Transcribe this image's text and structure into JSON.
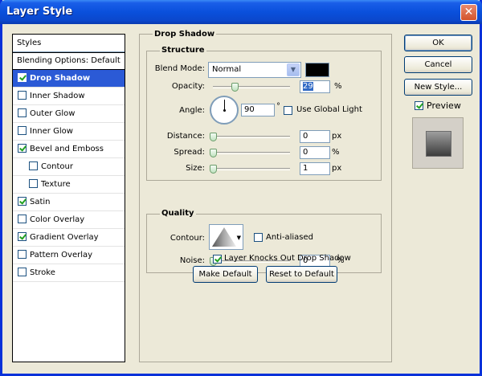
{
  "window": {
    "title": "Layer Style",
    "close_glyph": "✕"
  },
  "styles_panel": {
    "header": "Styles",
    "blending_options": "Blending Options: Default",
    "items": [
      {
        "label": "Drop Shadow",
        "checked": true,
        "selected": true,
        "sub": false
      },
      {
        "label": "Inner Shadow",
        "checked": false,
        "selected": false,
        "sub": false
      },
      {
        "label": "Outer Glow",
        "checked": false,
        "selected": false,
        "sub": false
      },
      {
        "label": "Inner Glow",
        "checked": false,
        "selected": false,
        "sub": false
      },
      {
        "label": "Bevel and Emboss",
        "checked": true,
        "selected": false,
        "sub": false
      },
      {
        "label": "Contour",
        "checked": false,
        "selected": false,
        "sub": true
      },
      {
        "label": "Texture",
        "checked": false,
        "selected": false,
        "sub": true
      },
      {
        "label": "Satin",
        "checked": true,
        "selected": false,
        "sub": false
      },
      {
        "label": "Color Overlay",
        "checked": false,
        "selected": false,
        "sub": false
      },
      {
        "label": "Gradient Overlay",
        "checked": true,
        "selected": false,
        "sub": false
      },
      {
        "label": "Pattern Overlay",
        "checked": false,
        "selected": false,
        "sub": false
      },
      {
        "label": "Stroke",
        "checked": false,
        "selected": false,
        "sub": false
      }
    ]
  },
  "drop_shadow": {
    "section_title": "Drop Shadow",
    "structure": {
      "title": "Structure",
      "blend_mode_label": "Blend Mode:",
      "blend_mode_value": "Normal",
      "blend_color": "#000000",
      "opacity_label": "Opacity:",
      "opacity_value": "29",
      "opacity_unit": "%",
      "angle_label": "Angle:",
      "angle_value": "90",
      "angle_unit": "°",
      "use_global_light_label": "Use Global Light",
      "use_global_light_checked": false,
      "distance_label": "Distance:",
      "distance_value": "0",
      "distance_unit": "px",
      "spread_label": "Spread:",
      "spread_value": "0",
      "spread_unit": "%",
      "size_label": "Size:",
      "size_value": "1",
      "size_unit": "px"
    },
    "quality": {
      "title": "Quality",
      "contour_label": "Contour:",
      "anti_aliased_label": "Anti-aliased",
      "anti_aliased_checked": false,
      "noise_label": "Noise:",
      "noise_value": "0",
      "noise_unit": "%"
    },
    "knockout_label": "Layer Knocks Out Drop Shadow",
    "knockout_checked": true,
    "make_default_label": "Make Default",
    "reset_default_label": "Reset to Default"
  },
  "actions": {
    "ok_label": "OK",
    "cancel_label": "Cancel",
    "new_style_label": "New Style...",
    "preview_label": "Preview",
    "preview_checked": true
  }
}
